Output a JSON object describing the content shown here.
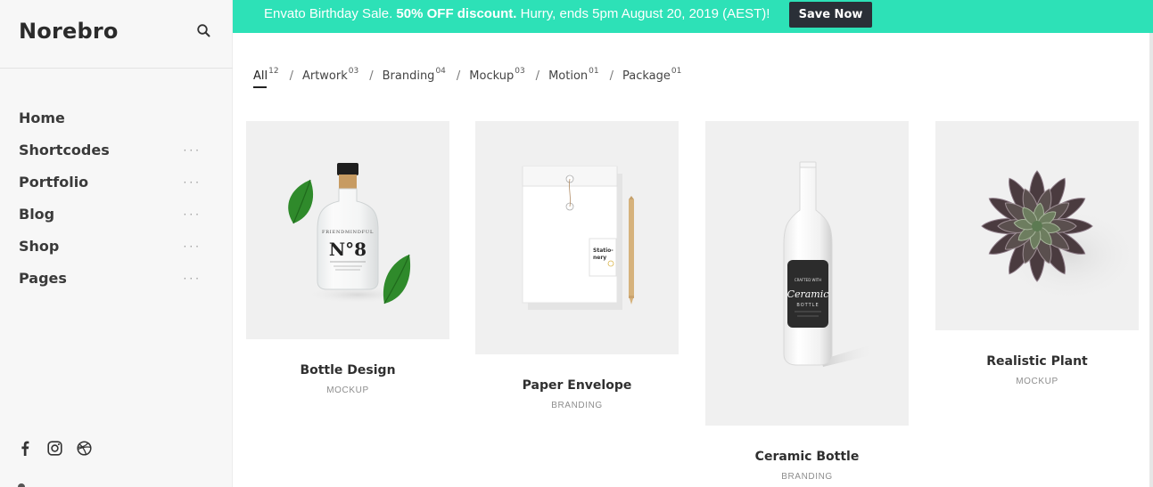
{
  "sidebar": {
    "logo": "Norebro",
    "nav": [
      {
        "label": "Home",
        "has_submenu": false
      },
      {
        "label": "Shortcodes",
        "has_submenu": true
      },
      {
        "label": "Portfolio",
        "has_submenu": true
      },
      {
        "label": "Blog",
        "has_submenu": true
      },
      {
        "label": "Shop",
        "has_submenu": true
      },
      {
        "label": "Pages",
        "has_submenu": true
      }
    ],
    "submenu_indicator": "···",
    "social_icons": [
      "facebook-icon",
      "instagram-icon",
      "dribbble-icon"
    ]
  },
  "promo": {
    "text_pre": "Envato Birthday Sale. ",
    "text_bold": "50% OFF discount.",
    "text_post": " Hurry, ends 5pm August 20, 2019 (AEST)!",
    "button_label": "Save Now",
    "bg_color": "#2de1b7",
    "button_color": "#2a2f37"
  },
  "filters": [
    {
      "label": "All",
      "count": "12",
      "active": true
    },
    {
      "label": "Artwork",
      "count": "03",
      "active": false
    },
    {
      "label": "Branding",
      "count": "04",
      "active": false
    },
    {
      "label": "Mockup",
      "count": "03",
      "active": false
    },
    {
      "label": "Motion",
      "count": "01",
      "active": false
    },
    {
      "label": "Package",
      "count": "01",
      "active": false
    }
  ],
  "filter_separator": "/",
  "portfolio": [
    {
      "title": "Bottle Design",
      "category": "MOCKUP",
      "image": "glass-bottle-no8-with-leaves"
    },
    {
      "title": "Paper Envelope",
      "category": "BRANDING",
      "image": "stationery-envelope-with-pencil"
    },
    {
      "title": "Ceramic Bottle",
      "category": "BRANDING",
      "image": "white-ceramic-bottle"
    },
    {
      "title": "Realistic Plant",
      "category": "MOCKUP",
      "image": "succulent-plant-top-view"
    }
  ],
  "artwork_text": {
    "bottle_brand": "FRIENDMINDFUL",
    "bottle_number": "N°8",
    "envelope_tag": "Statio-\nnery",
    "ceramic_label_1": "Ceramic",
    "ceramic_label_2": "BOTTLE"
  }
}
